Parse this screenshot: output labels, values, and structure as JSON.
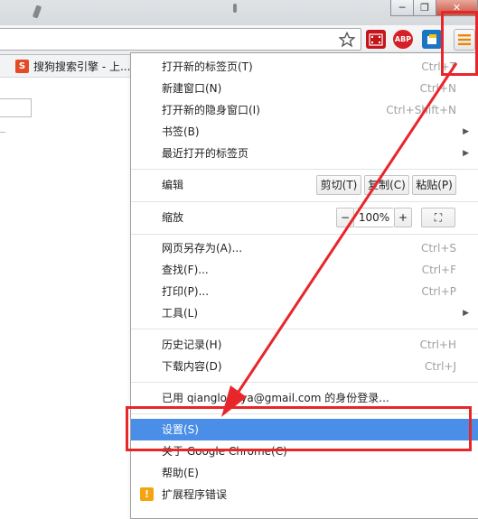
{
  "window": {
    "minimize_glyph": "─",
    "restore_glyph": "❐",
    "close_glyph": "✕"
  },
  "extensions": {
    "abp_label": "ABP"
  },
  "bookmarks": {
    "tab_favicon_letter": "S",
    "tab_title": "搜狗搜索引擎 - 上..."
  },
  "menu": {
    "items": [
      {
        "label": "打开新的标签页(T)",
        "shortcut": "Ctrl+T"
      },
      {
        "label": "新建窗口(N)",
        "shortcut": "Ctrl+N"
      },
      {
        "label": "打开新的隐身窗口(I)",
        "shortcut": "Ctrl+Shift+N"
      },
      {
        "label": "书签(B)",
        "submenu": "▶"
      },
      {
        "label": "最近打开的标签页",
        "submenu": "▶"
      }
    ],
    "edit": {
      "label": "编辑",
      "cut": "剪切(T)",
      "copy": "复制(C)",
      "paste": "粘贴(P)"
    },
    "zoom": {
      "label": "缩放",
      "minus": "−",
      "value": "100%",
      "plus": "+",
      "fullscreen": "⛶"
    },
    "items2": [
      {
        "label": "网页另存为(A)...",
        "shortcut": "Ctrl+S"
      },
      {
        "label": "查找(F)...",
        "shortcut": "Ctrl+F"
      },
      {
        "label": "打印(P)...",
        "shortcut": "Ctrl+P"
      },
      {
        "label": "工具(L)",
        "submenu": "▶"
      }
    ],
    "items3": [
      {
        "label": "历史记录(H)",
        "shortcut": "Ctrl+H"
      },
      {
        "label": "下载内容(D)",
        "shortcut": "Ctrl+J"
      }
    ],
    "signin": "已用 qianglongya@gmail.com 的身份登录...",
    "settings": "设置(S)",
    "about": "关于 Google Chrome(C)",
    "help": "帮助(E)",
    "ext_error": "扩展程序错误",
    "ext_error_glyph": "!"
  },
  "annotation_color": "#e8262a"
}
